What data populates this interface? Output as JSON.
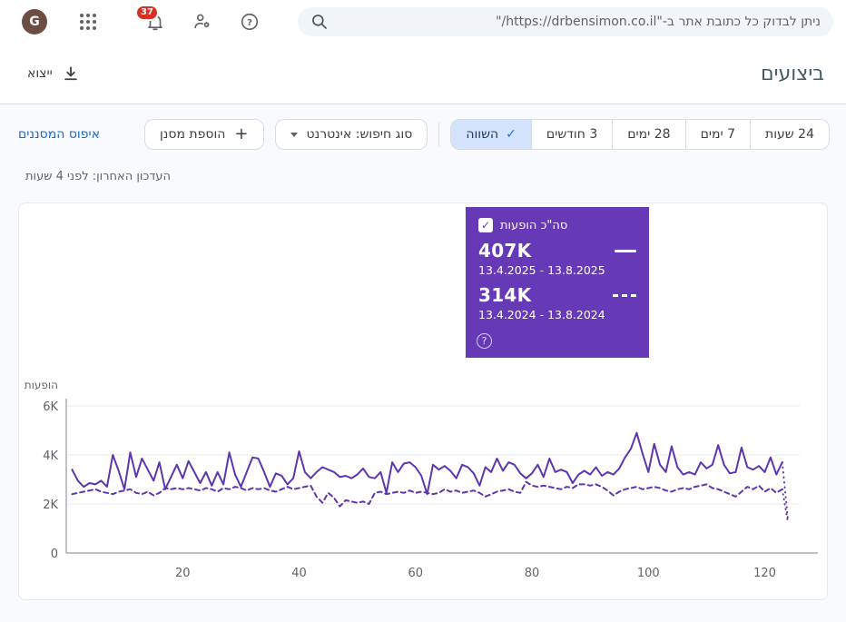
{
  "topbar": {
    "avatar_letter": "G",
    "notification_count": "37",
    "search_placeholder": "ניתן לבדוק כל כתובת אתר ב-\"https://drbensimon.co.il/\""
  },
  "header": {
    "title": "ביצועים",
    "export_label": "ייצוא"
  },
  "toolbar": {
    "date_tabs": [
      {
        "label": "24 שעות",
        "selected": false
      },
      {
        "label": "7 ימים",
        "selected": false
      },
      {
        "label": "28 ימים",
        "selected": false
      },
      {
        "label": "3 חודשים",
        "selected": false
      },
      {
        "label": "השווה",
        "selected": true
      }
    ],
    "search_type_label": "סוג חיפוש: אינטרנט",
    "add_filter_label": "הוספת מסנן",
    "reset_filters_label": "איפוס המסננים"
  },
  "status": {
    "last_update": "העדכון האחרון: לפני 4 שעות"
  },
  "legend": {
    "metric_label": "סה\"כ הופעות",
    "entries": [
      {
        "total": "407K",
        "period": "13.4.2025 - 13.8.2025",
        "style": "solid"
      },
      {
        "total": "314K",
        "period": "13.4.2024 - 13.8.2024",
        "style": "dashed"
      }
    ]
  },
  "chart_data": {
    "type": "line",
    "title": "סה\"כ הופעות",
    "ylabel": "הופעות",
    "ylim": [
      0,
      6000
    ],
    "y_ticks": [
      {
        "v": 0,
        "label": "0"
      },
      {
        "v": 2000,
        "label": "2K"
      },
      {
        "v": 4000,
        "label": "4K"
      },
      {
        "v": 6000,
        "label": "6K"
      }
    ],
    "x_ticks": [
      20,
      40,
      60,
      80,
      100,
      120
    ],
    "x_range": [
      1,
      126
    ],
    "grid": "horizontal",
    "line_color": "#5e35b1",
    "last_segment_style": "dotted",
    "series": [
      {
        "name": "13.4.2025 - 13.8.2025",
        "total": "407K",
        "style": "solid",
        "values": [
          3400,
          2950,
          2700,
          2850,
          2800,
          2950,
          2700,
          4000,
          3350,
          2600,
          4100,
          3100,
          3850,
          3400,
          2950,
          3700,
          2600,
          3100,
          3600,
          3050,
          3750,
          3300,
          2850,
          3300,
          2750,
          3300,
          2800,
          4100,
          3200,
          2700,
          3300,
          3900,
          3850,
          3300,
          2700,
          3250,
          3150,
          2800,
          3050,
          4150,
          3300,
          3050,
          3300,
          3500,
          3400,
          3300,
          3100,
          3150,
          3050,
          3200,
          3450,
          3100,
          3050,
          3300,
          2450,
          3700,
          3300,
          3650,
          3700,
          3500,
          3150,
          2400,
          3600,
          3400,
          3550,
          3350,
          3050,
          3600,
          3500,
          3250,
          2750,
          3500,
          3300,
          3850,
          3350,
          3700,
          3600,
          3250,
          3050,
          3250,
          3600,
          3100,
          3850,
          3300,
          3400,
          3300,
          2850,
          3200,
          3350,
          3200,
          3500,
          3150,
          3300,
          3200,
          3450,
          3900,
          4250,
          4900,
          4050,
          3300,
          4450,
          3600,
          3300,
          4350,
          3500,
          3200,
          3300,
          3200,
          3700,
          3450,
          3600,
          4400,
          3600,
          3250,
          3300,
          4300,
          3500,
          3400,
          3550,
          3300,
          3900,
          3200,
          3700,
          1300
        ]
      },
      {
        "name": "13.4.2024 - 13.8.2024",
        "total": "314K",
        "style": "dashed",
        "values": [
          2400,
          2450,
          2500,
          2550,
          2600,
          2500,
          2450,
          2400,
          2500,
          2550,
          2600,
          2450,
          2400,
          2500,
          2350,
          2450,
          2650,
          2600,
          2650,
          2600,
          2650,
          2600,
          2550,
          2650,
          2600,
          2500,
          2650,
          2600,
          2700,
          2650,
          2550,
          2650,
          2600,
          2650,
          2550,
          2500,
          2600,
          2700,
          2600,
          2650,
          2700,
          2750,
          2300,
          2050,
          2450,
          2250,
          1900,
          2150,
          2100,
          2050,
          2100,
          2000,
          2450,
          2500,
          2400,
          2450,
          2500,
          2450,
          2550,
          2450,
          2500,
          2450,
          2400,
          2450,
          2600,
          2500,
          2550,
          2450,
          2500,
          2550,
          2450,
          2300,
          2400,
          2500,
          2550,
          2600,
          2500,
          2450,
          2900,
          2750,
          2700,
          2750,
          2700,
          2650,
          2600,
          2700,
          2650,
          2800,
          2800,
          2750,
          2800,
          2700,
          2550,
          2350,
          2500,
          2600,
          2650,
          2700,
          2600,
          2650,
          2700,
          2650,
          2550,
          2500,
          2600,
          2650,
          2600,
          2700,
          2750,
          2800,
          2650,
          2600,
          2500,
          2400,
          2300,
          2500,
          2700,
          2600,
          2750,
          2500,
          2650,
          2450,
          2600,
          1200
        ]
      }
    ]
  }
}
